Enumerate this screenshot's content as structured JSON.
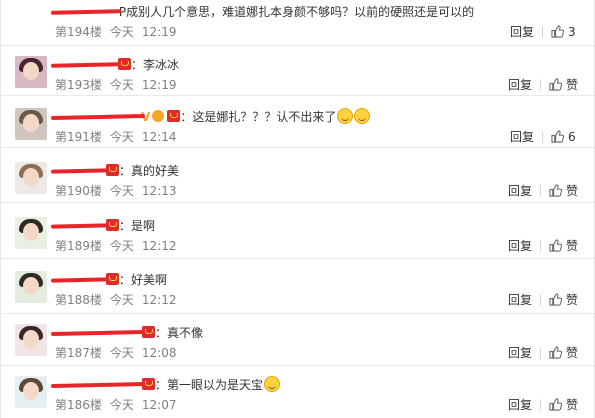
{
  "comments": [
    {
      "name": "　　　　　",
      "text": "P成别人几个意思，难道娜扎本身颜不够吗？以前的硬照还是可以的",
      "floor": "第194楼",
      "day": "今天",
      "time": "12:19",
      "reply": "回复",
      "likes": "3"
    },
    {
      "name": "　　　　　",
      "text": "：李冰冰",
      "floor": "第193楼",
      "day": "今天",
      "time": "12:19",
      "reply": "回复",
      "likes": "赞"
    },
    {
      "name": "　　　　　　　",
      "text": "：这是娜扎？？？认不出来了",
      "floor": "第191楼",
      "day": "今天",
      "time": "12:14",
      "reply": "回复",
      "likes": "6"
    },
    {
      "name": "　　　　",
      "text": "：真的好美",
      "floor": "第190楼",
      "day": "今天",
      "time": "12:13",
      "reply": "回复",
      "likes": "赞"
    },
    {
      "name": "　　　　",
      "text": "：是啊",
      "floor": "第189楼",
      "day": "今天",
      "time": "12:12",
      "reply": "回复",
      "likes": "赞"
    },
    {
      "name": "　　　　",
      "text": "：好美啊",
      "floor": "第188楼",
      "day": "今天",
      "time": "12:12",
      "reply": "回复",
      "likes": "赞"
    },
    {
      "name": "　　　　　　　",
      "text": "：真不像",
      "floor": "第187楼",
      "day": "今天",
      "time": "12:08",
      "reply": "回复",
      "likes": "赞"
    },
    {
      "name": "　　　　　　　",
      "text": "：第一眼以为是天宝",
      "floor": "第186楼",
      "day": "今天",
      "time": "12:07",
      "reply": "回复",
      "likes": "赞"
    }
  ],
  "colors": {
    "name": "#eb7350",
    "meta": "#808080",
    "redaction": "#e8262a"
  }
}
